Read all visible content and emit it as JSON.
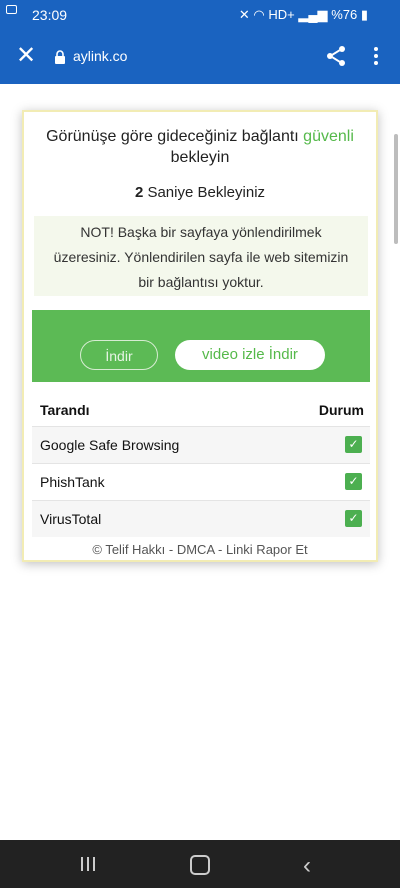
{
  "status_bar": {
    "time": "23:09",
    "network": "HD+",
    "battery": "%76"
  },
  "browser": {
    "url": "aylink.co"
  },
  "card": {
    "title_prefix": "Görünüşe göre gideceğiniz bağlantı ",
    "title_highlight": "güvenli",
    "title_suffix": "bekleyin",
    "countdown_number": "2",
    "countdown_text": " Saniye Bekleyiniz",
    "note_line1": "NOT! Başka bir sayfaya yönlendirilmek",
    "note_line2": "üzeresiniz. Yönlendirilen sayfa ile web sitemizin",
    "note_line3": "bir bağlantısı yoktur.",
    "button_indir": "İndir",
    "button_video": "video izle İndir",
    "table": {
      "col_scanned": "Tarandı",
      "col_status": "Durum",
      "rows": [
        {
          "name": "Google Safe Browsing",
          "status": "✓"
        },
        {
          "name": "PhishTank",
          "status": "✓"
        },
        {
          "name": "VirusTotal",
          "status": "✓"
        }
      ]
    },
    "footer": "© Telif Hakkı - DMCA - Linki Rapor Et"
  }
}
